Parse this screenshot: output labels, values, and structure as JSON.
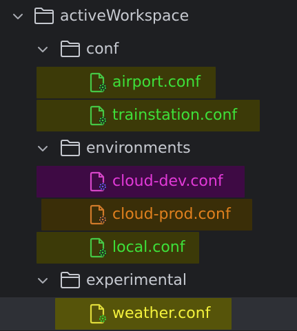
{
  "tree": {
    "root": {
      "label": "activeWorkspace"
    },
    "folders": [
      {
        "label": "conf",
        "files": [
          {
            "label": "airport.conf",
            "text_color": "#3ee03a",
            "highlight_color": "#3c3a08",
            "icon_color": "#46c846",
            "badge_color": "#36d636"
          },
          {
            "label": "trainstation.conf",
            "text_color": "#3ee03a",
            "highlight_color": "#3c3a08",
            "icon_color": "#46c846",
            "badge_color": "#36d636"
          }
        ]
      },
      {
        "label": "environments",
        "files": [
          {
            "label": "cloud-dev.conf",
            "text_color": "#e23ad8",
            "highlight_color": "#3e0a44",
            "icon_color": "#d646c8",
            "badge_color": "#7a40ff"
          },
          {
            "label": "cloud-prod.conf",
            "text_color": "#e0801e",
            "highlight_color": "#3a2e08",
            "icon_color": "#d07a2a",
            "badge_color": "#d07a2a"
          },
          {
            "label": "local.conf",
            "text_color": "#3ee03a",
            "highlight_color": "#3c3a08",
            "icon_color": "#46c846",
            "badge_color": "#36d636"
          }
        ]
      },
      {
        "label": "experimental",
        "files": [
          {
            "label": "weather.conf",
            "text_color": "#f4f23c",
            "highlight_color": "#56540a",
            "icon_color": "#e0dc3a",
            "badge_color": "#36d636"
          }
        ]
      }
    ],
    "selected_file": "weather.conf",
    "colors": {
      "background": "#1e1f22",
      "selected_row": "#2e3036",
      "folder_text": "#c7cad1",
      "folder_icon": "#c7cad1",
      "chevron": "#a9acb3"
    }
  }
}
